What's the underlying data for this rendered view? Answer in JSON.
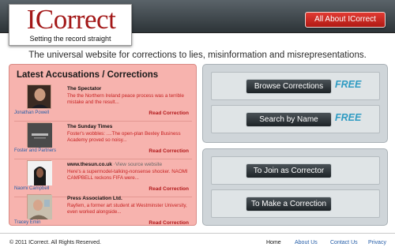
{
  "logo": {
    "text": "ICorrect",
    "tagline": "Setting the record straight"
  },
  "header": {
    "about_button": "All About ICorrect"
  },
  "tagline": "The universal website for corrections to lies, misinformation and misrepresentations.",
  "accusations": {
    "title": "Latest Accusations / Corrections",
    "items": [
      {
        "caption": "Jonathan Powell",
        "source": "The Spectator",
        "source_note": "",
        "text": "The the Northern Ireland peace process was a terrible mistake and the result...",
        "link": "Read Correction"
      },
      {
        "caption": "Foster and Partners",
        "source": "The Sunday Times",
        "source_note": "",
        "text": "Foster's wobbles: ....The open-plan Bexley Business Academy proved so noisy...",
        "link": "Read Correction"
      },
      {
        "caption": "Naomi Campbell",
        "source": "www.thesun.co.uk",
        "source_note": "View source website",
        "text": "Here's a supermodel-talking-nonsense shocker. NAOMI CAMPBELL reckons FIFA were...",
        "link": "Read Correction"
      },
      {
        "caption": "Tracey Emin",
        "source": "Press Association Ltd.",
        "source_note": "",
        "text": "Rayfem, a former art student at Westminster University, even worked alongside...",
        "link": "Read Correction"
      }
    ]
  },
  "actions": {
    "browse": "Browse Corrections",
    "search": "Search by Name",
    "free": "FREE",
    "join": "To Join as Corrector",
    "make": "To Make a Correction"
  },
  "footer": {
    "copyright": "© 2011 ICorrect. All Rights Reserved.",
    "links": {
      "home": "Home",
      "about": "About Us",
      "contact": "Contact Us",
      "privacy": "Privacy"
    }
  },
  "colors": {
    "brand_red": "#a31818",
    "panel_pink": "#f7b3ae",
    "panel_grey": "#cfd5d9",
    "free_blue": "#2f9bc2"
  }
}
